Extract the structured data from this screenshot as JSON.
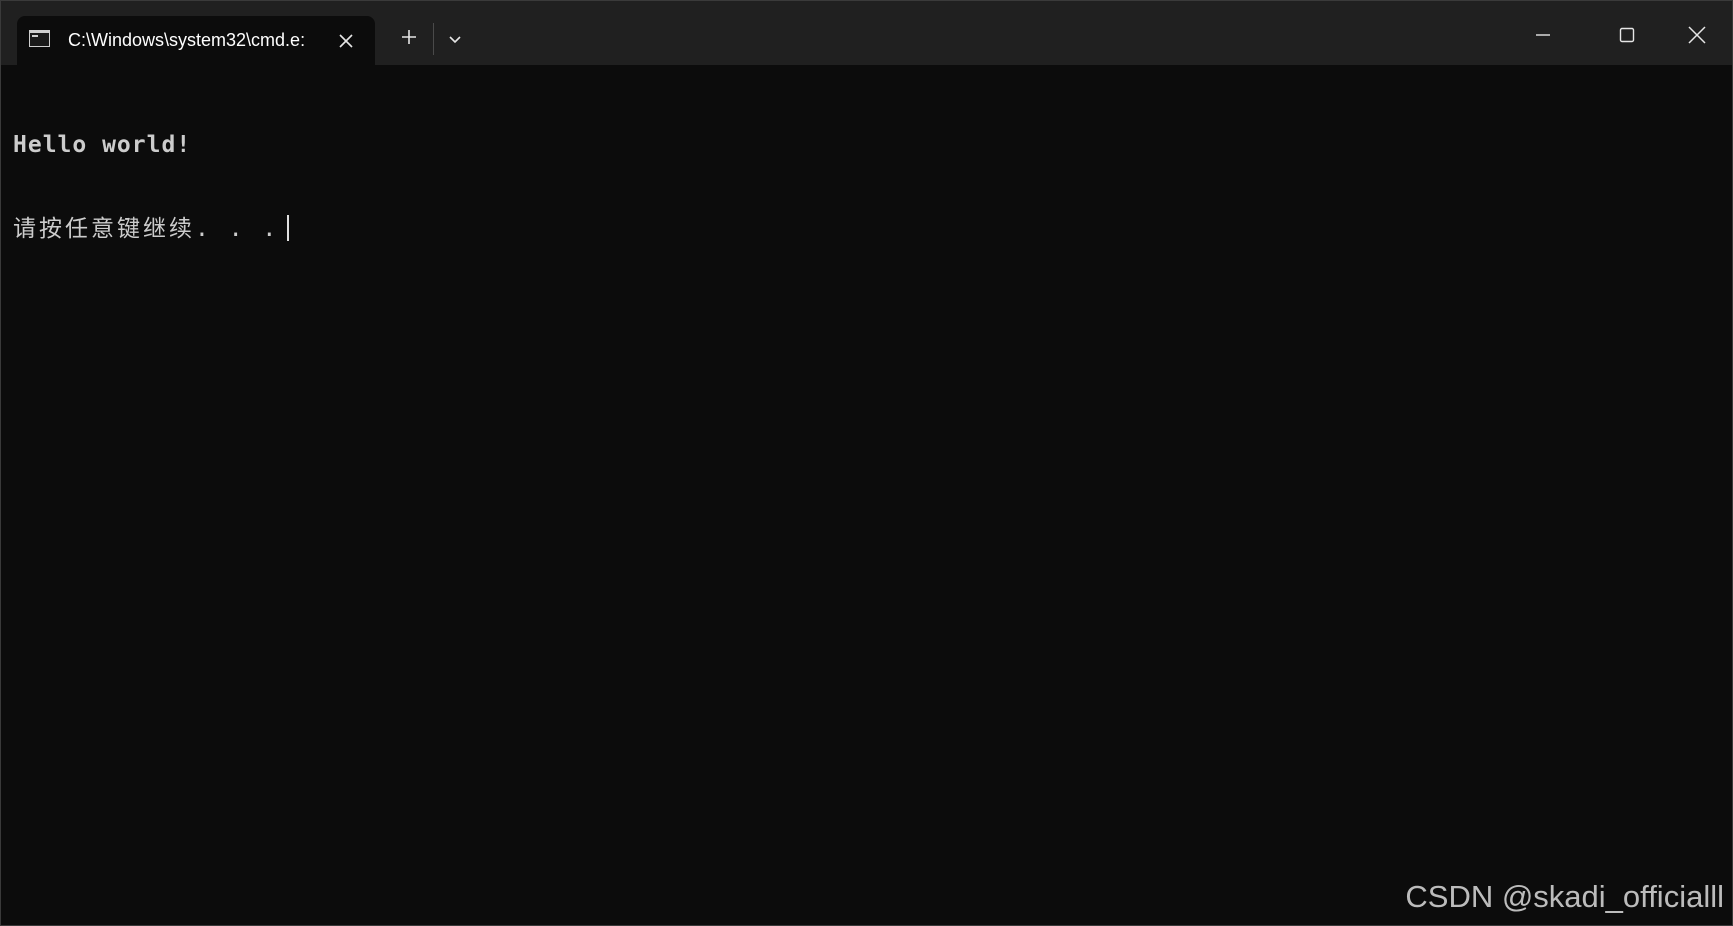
{
  "window": {
    "tab_title": "C:\\Windows\\system32\\cmd.e:",
    "icons": {
      "tab_icon": "terminal-icon",
      "tab_close": "close-icon",
      "new_tab": "plus-icon",
      "dropdown": "chevron-down-icon",
      "minimize": "minimize-icon",
      "maximize": "maximize-icon",
      "close": "close-icon"
    }
  },
  "terminal": {
    "lines": [
      "Hello world!",
      "请按任意键继续. . ."
    ]
  },
  "watermark": "CSDN @skadi_officialll",
  "colors": {
    "background": "#0c0c0c",
    "titlebar": "#202020",
    "text": "#cccccc"
  }
}
